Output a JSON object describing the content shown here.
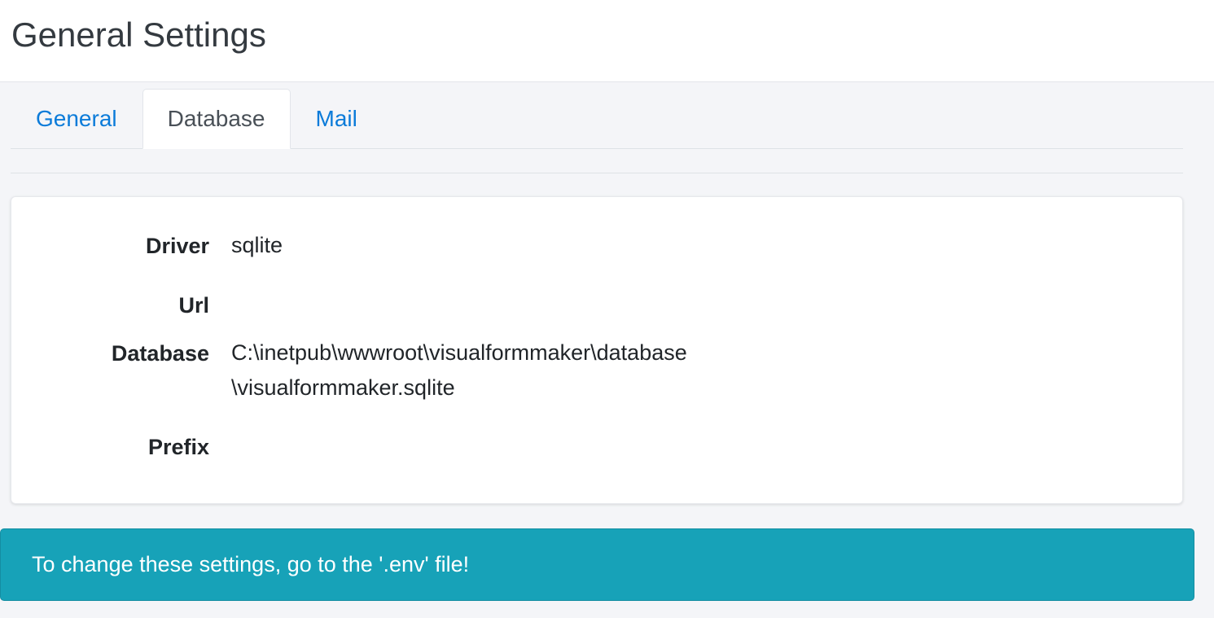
{
  "page": {
    "title": "General Settings"
  },
  "tabs": [
    {
      "label": "General",
      "active": false
    },
    {
      "label": "Database",
      "active": true
    },
    {
      "label": "Mail",
      "active": false
    }
  ],
  "database": {
    "fields": [
      {
        "label": "Driver",
        "value": "sqlite"
      },
      {
        "label": "Url",
        "value": ""
      },
      {
        "label": "Database",
        "value_line1": "C:\\inetpub\\wwwroot\\visualformmaker\\database",
        "value_line2": "\\visualformmaker.sqlite"
      },
      {
        "label": "Prefix",
        "value": ""
      }
    ]
  },
  "alert": {
    "message": "To change these settings, go to the '.env' file!"
  },
  "colors": {
    "link": "#0b7bd9",
    "alert_bg": "#17a2b8",
    "page_bg": "#f4f5f8"
  }
}
